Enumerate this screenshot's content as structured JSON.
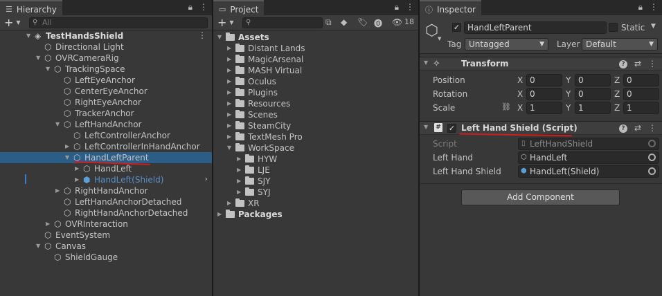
{
  "hierarchy": {
    "tab_label": "Hierarchy",
    "search_placeholder": "All",
    "rows": [
      {
        "label": "TestHandsShield",
        "depth": 0,
        "arrow": "down",
        "icon": "unity",
        "style": "bold"
      },
      {
        "label": "Directional Light",
        "depth": 1,
        "arrow": "",
        "icon": "cube"
      },
      {
        "label": "OVRCameraRig",
        "depth": 1,
        "arrow": "down",
        "icon": "cube"
      },
      {
        "label": "TrackingSpace",
        "depth": 2,
        "arrow": "down",
        "icon": "cube"
      },
      {
        "label": "LeftEyeAnchor",
        "depth": 3,
        "arrow": "",
        "icon": "cube"
      },
      {
        "label": "CenterEyeAnchor",
        "depth": 3,
        "arrow": "",
        "icon": "cube"
      },
      {
        "label": "RightEyeAnchor",
        "depth": 3,
        "arrow": "",
        "icon": "cube"
      },
      {
        "label": "TrackerAnchor",
        "depth": 3,
        "arrow": "",
        "icon": "cube"
      },
      {
        "label": "LeftHandAnchor",
        "depth": 3,
        "arrow": "down",
        "icon": "cube"
      },
      {
        "label": "LeftControllerAnchor",
        "depth": 4,
        "arrow": "",
        "icon": "cube"
      },
      {
        "label": "LeftControllerInHandAnchor",
        "depth": 4,
        "arrow": "right",
        "icon": "cube"
      },
      {
        "label": "HandLeftParent",
        "depth": 4,
        "arrow": "down",
        "icon": "cube",
        "style": "selected"
      },
      {
        "label": "HandLeft",
        "depth": 5,
        "arrow": "right",
        "icon": "cube"
      },
      {
        "label": "HandLeft(Shield)",
        "depth": 5,
        "arrow": "right",
        "icon": "prefab",
        "style": "blue"
      },
      {
        "label": "RightHandAnchor",
        "depth": 3,
        "arrow": "right",
        "icon": "cube"
      },
      {
        "label": "LeftHandAnchorDetached",
        "depth": 3,
        "arrow": "",
        "icon": "cube"
      },
      {
        "label": "RightHandAnchorDetached",
        "depth": 3,
        "arrow": "",
        "icon": "cube"
      },
      {
        "label": "OVRInteraction",
        "depth": 2,
        "arrow": "right",
        "icon": "cube"
      },
      {
        "label": "EventSystem",
        "depth": 1,
        "arrow": "",
        "icon": "cube"
      },
      {
        "label": "Canvas",
        "depth": 1,
        "arrow": "down",
        "icon": "cube"
      },
      {
        "label": "ShieldGauge",
        "depth": 2,
        "arrow": "",
        "icon": "cube"
      }
    ]
  },
  "project": {
    "tab_label": "Project",
    "hidden_count": "18",
    "rows": [
      {
        "label": "Assets",
        "depth": 0,
        "arrow": "down",
        "style": "bold"
      },
      {
        "label": "Distant Lands",
        "depth": 1,
        "arrow": "right"
      },
      {
        "label": "MagicArsenal",
        "depth": 1,
        "arrow": "right"
      },
      {
        "label": "MASH Virtual",
        "depth": 1,
        "arrow": "right"
      },
      {
        "label": "Oculus",
        "depth": 1,
        "arrow": "right"
      },
      {
        "label": "Plugins",
        "depth": 1,
        "arrow": "right"
      },
      {
        "label": "Resources",
        "depth": 1,
        "arrow": "right"
      },
      {
        "label": "Scenes",
        "depth": 1,
        "arrow": "right"
      },
      {
        "label": "SteamCity",
        "depth": 1,
        "arrow": "right"
      },
      {
        "label": "TextMesh Pro",
        "depth": 1,
        "arrow": "right"
      },
      {
        "label": "WorkSpace",
        "depth": 1,
        "arrow": "down"
      },
      {
        "label": "HYW",
        "depth": 2,
        "arrow": "right"
      },
      {
        "label": "LJE",
        "depth": 2,
        "arrow": "right"
      },
      {
        "label": "SJY",
        "depth": 2,
        "arrow": "right"
      },
      {
        "label": "SYJ",
        "depth": 2,
        "arrow": "right"
      },
      {
        "label": "XR",
        "depth": 1,
        "arrow": "right"
      },
      {
        "label": "Packages",
        "depth": 0,
        "arrow": "right",
        "style": "bold"
      }
    ]
  },
  "inspector": {
    "tab_label": "Inspector",
    "object_name": "HandLeftParent",
    "static_label": "Static",
    "tag_label": "Tag",
    "tag_value": "Untagged",
    "layer_label": "Layer",
    "layer_value": "Default",
    "transform": {
      "title": "Transform",
      "position_label": "Position",
      "rotation_label": "Rotation",
      "scale_label": "Scale",
      "axis_x": "X",
      "axis_y": "Y",
      "axis_z": "Z",
      "position": [
        "0",
        "0",
        "0"
      ],
      "rotation": [
        "0",
        "0",
        "0"
      ],
      "scale": [
        "1",
        "1",
        "1"
      ]
    },
    "script_component": {
      "title": "Left Hand Shield (Script)",
      "script_label": "Script",
      "script_value": "LeftHandShield",
      "left_hand_label": "Left Hand",
      "left_hand_value": "HandLeft",
      "left_hand_shield_label": "Left Hand Shield",
      "left_hand_shield_value": "HandLeft(Shield)"
    },
    "add_component_label": "Add Component"
  },
  "colors": {
    "selection": "#2c5d87",
    "prefab_text": "#5a8fc9",
    "annotation_red": "#d21c1c"
  }
}
